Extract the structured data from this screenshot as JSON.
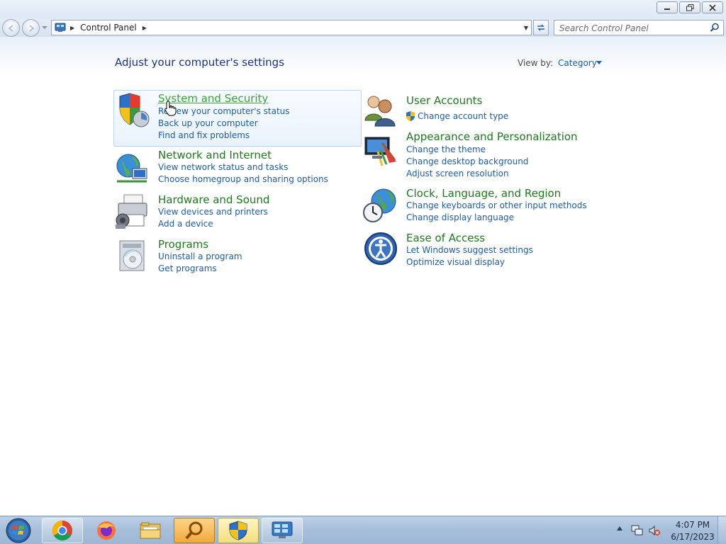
{
  "address": {
    "breadcrumb": [
      "Control Panel"
    ],
    "search_placeholder": "Search Control Panel"
  },
  "header": {
    "title": "Adjust your computer's settings",
    "view_by_label": "View by:",
    "view_by_value": "Category"
  },
  "categories_left": [
    {
      "title": "System and Security",
      "icon": "shield-icon",
      "links": [
        "Review your computer's status",
        "Back up your computer",
        "Find and fix problems"
      ]
    },
    {
      "title": "Network and Internet",
      "icon": "network-globe-icon",
      "links": [
        "View network status and tasks",
        "Choose homegroup and sharing options"
      ]
    },
    {
      "title": "Hardware and Sound",
      "icon": "printer-speaker-icon",
      "links": [
        "View devices and printers",
        "Add a device"
      ]
    },
    {
      "title": "Programs",
      "icon": "programs-disc-icon",
      "links": [
        "Uninstall a program",
        "Get programs"
      ]
    }
  ],
  "categories_right": [
    {
      "title": "User Accounts",
      "icon": "users-icon",
      "links": [
        "Change account type"
      ]
    },
    {
      "title": "Appearance and Personalization",
      "icon": "monitor-paint-icon",
      "links": [
        "Change the theme",
        "Change desktop background",
        "Adjust screen resolution"
      ]
    },
    {
      "title": "Clock, Language, and Region",
      "icon": "globe-clock-icon",
      "links": [
        "Change keyboards or other input methods",
        "Change display language"
      ]
    },
    {
      "title": "Ease of Access",
      "icon": "ease-of-access-icon",
      "links": [
        "Let Windows suggest settings",
        "Optimize visual display"
      ]
    }
  ],
  "taskbar": {
    "items": [
      "chrome-icon",
      "firefox-icon",
      "file-explorer-icon",
      "search-magnifier-icon",
      "security-shield-icon",
      "control-panel-icon"
    ],
    "clock_time": "4:07 PM",
    "clock_date": "6/17/2023"
  },
  "colors": {
    "category_title": "#1e7a1e",
    "link": "#1f5ca9",
    "page_title": "#1e3287"
  }
}
